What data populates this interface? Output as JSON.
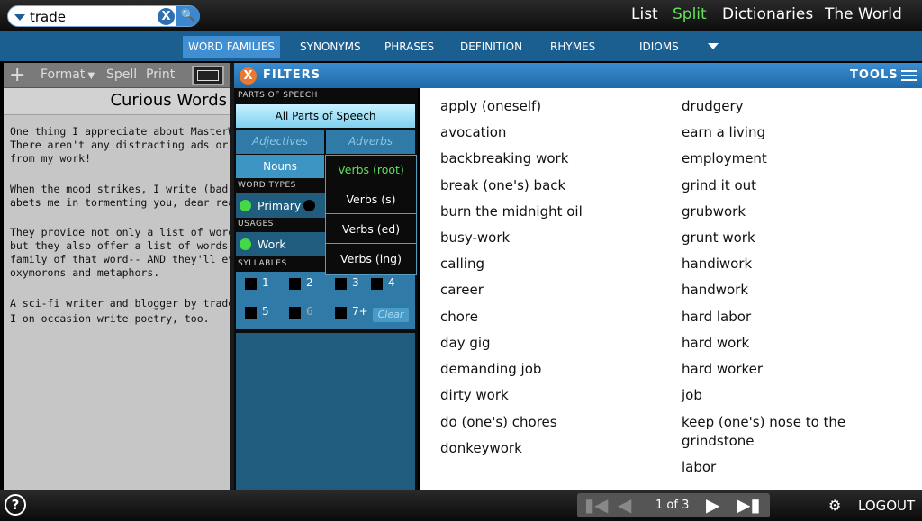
{
  "search": {
    "value": "trade"
  },
  "nav": {
    "list": "List",
    "split": "Split",
    "dictionaries": "Dictionaries",
    "world": "The World"
  },
  "tabs": [
    "WORD FAMILIES",
    "SYNONYMS",
    "PHRASES",
    "DEFINITION",
    "RHYMES",
    "IDIOMS"
  ],
  "editor": {
    "toolbar": {
      "add": "+",
      "format": "Format",
      "spell": "Spell",
      "print": "Print"
    },
    "title": "Curious Words",
    "lines": [
      "One thing I appreciate about MasterWrit",
      "There aren't any distracting ads or imag",
      "from my work!",
      "",
      "When the mood strikes, I write (bad) po",
      "abets me in tormenting you, dear reader",
      "",
      "They provide not only a list of words tha",
      "but they also offer a list of words and ph",
      "family of that word-- AND they'll even he",
      "oxymorons and metaphors.",
      "",
      "A sci-fi writer and blogger by trade,",
      "I on occasion write poetry, too."
    ]
  },
  "filters": {
    "header": "FILTERS",
    "parts_label": "PARTS OF SPEECH",
    "all_parts": "All Parts of Speech",
    "adjectives": "Adjectives",
    "adverbs": "Adverbs",
    "nouns": "Nouns",
    "verbs": [
      "Verbs (root)",
      "Verbs (s)",
      "Verbs (ed)",
      "Verbs (ing)"
    ],
    "word_types_label": "WORD TYPES",
    "primary": "Primary",
    "usages_label": "USAGES",
    "work": "Work",
    "syllables_label": "SYLLABLES",
    "syllables": [
      "1",
      "2",
      "3",
      "4",
      "5",
      "6",
      "7+"
    ],
    "clear": "Clear"
  },
  "tools": {
    "label": "TOOLS"
  },
  "results": {
    "col1": [
      "apply (oneself)",
      "avocation",
      "backbreaking work",
      "break (one's) back",
      "burn the midnight oil",
      "busy-work",
      "calling",
      "career",
      "chore",
      "day gig",
      "demanding job",
      "dirty work",
      "do (one's) chores",
      "donkeywork"
    ],
    "col2": [
      "drudgery",
      "earn a living",
      "employment",
      "grind it out",
      "grubwork",
      "grunt work",
      "handiwork",
      "handwork",
      "hard labor",
      "hard work",
      "hard worker",
      "job",
      "keep (one's) nose to the",
      "grindstone",
      "labor"
    ]
  },
  "pager": {
    "text": "1 of 3"
  },
  "bottom": {
    "help": "?",
    "logout": "LOGOUT"
  },
  "colors": {
    "accent": "#1b5f91",
    "active_tab": "#3f8fd2",
    "split_green": "#66e05a",
    "verbs_root_green": "#5ce05a"
  }
}
